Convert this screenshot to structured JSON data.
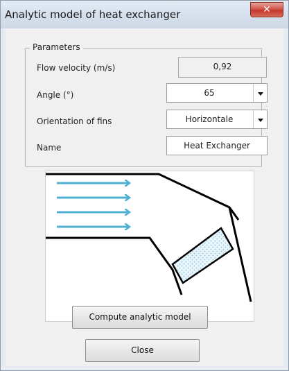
{
  "window": {
    "title": "Analytic model of heat exchanger",
    "close_glyph": "✕"
  },
  "parameters": {
    "legend": "Parameters",
    "flow_velocity": {
      "label": "Flow velocity (m/s)",
      "value": "0,92"
    },
    "angle": {
      "label": "Angle (°)",
      "value": "65"
    },
    "orientation": {
      "label": "Orientation of fins",
      "value": "Horizontale"
    },
    "name": {
      "label": "Name",
      "value": "Heat Exchanger"
    }
  },
  "diagram": {
    "flow_arrow_color": "#4fb0d4",
    "wall_color": "#000000",
    "fins_color": "#9ed3e6"
  },
  "buttons": {
    "compute_label": "Compute analytic model",
    "close_label": "Close"
  }
}
